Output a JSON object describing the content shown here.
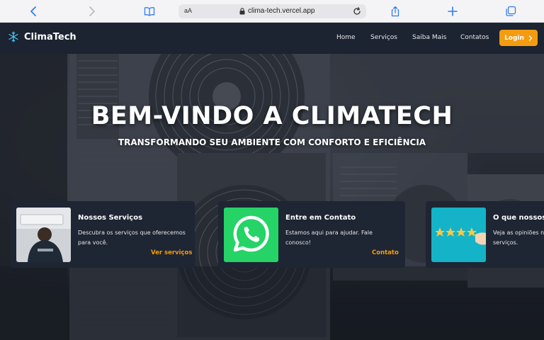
{
  "browser": {
    "url": "clima-tech.vercel.app",
    "text_size_label": "aA"
  },
  "navbar": {
    "brand": "ClimaTech",
    "links": [
      "Home",
      "Serviços",
      "Saiba Mais",
      "Contatos"
    ],
    "login_label": "Login"
  },
  "hero": {
    "title": "BEM-VINDO A CLIMATECH",
    "subtitle": "TRANSFORMANDO SEU AMBIENTE COM CONFORTO E EFICIÊNCIA"
  },
  "cards": [
    {
      "title": "Nossos Serviços",
      "description": "Descubra os serviços que oferecemos para você.",
      "link": "Ver serviços"
    },
    {
      "title": "Entre em Contato",
      "description": "Estamos aqui para ajudar. Fale conosco!",
      "link": "Contato"
    },
    {
      "title": "O que nossos c",
      "description": "Veja as opiniões nossos serviços.",
      "link": ""
    }
  ],
  "colors": {
    "accent": "#f39c12",
    "navbar": "#1c2331",
    "card": "#1e2533",
    "whatsapp": "#25d366"
  },
  "icons": [
    "back-icon",
    "forward-icon",
    "bookmarks-icon",
    "lock-icon",
    "reload-icon",
    "share-icon",
    "new-tab-icon",
    "tabs-icon",
    "snowflake-icon",
    "chevron-right-icon",
    "whatsapp-icon",
    "star-rating-icon"
  ]
}
